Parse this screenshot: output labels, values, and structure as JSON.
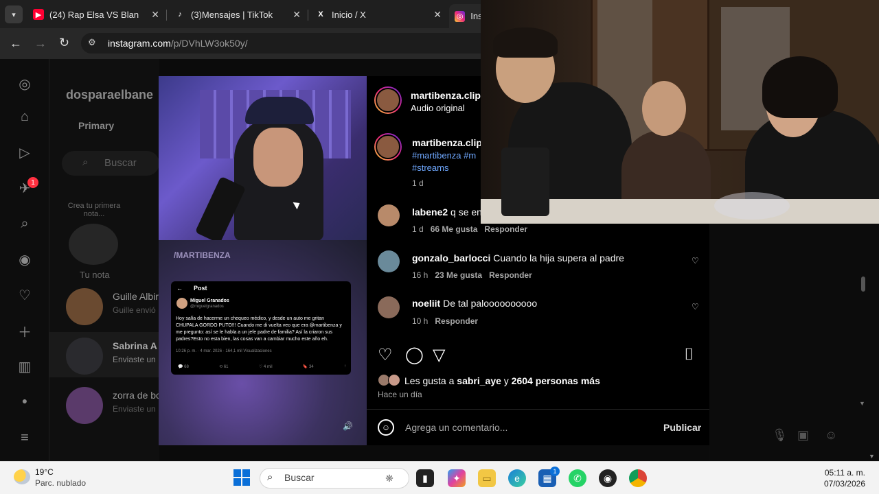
{
  "browser": {
    "tabs": [
      {
        "title": "(24) Rap Elsa VS Blancanieves",
        "favicon": "youtube-icon",
        "color": "#ff0033"
      },
      {
        "title": "(3)Mensajes | TikTok",
        "favicon": "tiktok-icon",
        "color": "#000000"
      },
      {
        "title": "Inicio / X",
        "favicon": "x-icon",
        "color": "#000000"
      },
      {
        "title": "Ins",
        "favicon": "instagram-icon",
        "color": "#e1306c"
      }
    ],
    "url_domain": "instagram.com",
    "url_path": "/p/DVhLW3ok50y/"
  },
  "sidebar": {
    "notification_count": "1"
  },
  "dm_panel": {
    "username": "dosparaelbane",
    "tab_primary": "Primary",
    "search_placeholder": "Buscar",
    "note_prompt": "Crea tu primera nota...",
    "your_note": "Tu nota",
    "conversations": [
      {
        "name": "Guille Albir",
        "preview": "Guille envió"
      },
      {
        "name": "Sabrina A",
        "preview": "Enviaste un"
      },
      {
        "name": "zorra de bo",
        "preview": "Enviaste un"
      }
    ]
  },
  "post": {
    "author": "martibenza.clips",
    "audio": "Audio original",
    "caption_user": "martibenza.clips",
    "hashtags_line1": "#martibenza #m",
    "hashtags_line2": "#streams",
    "caption_age": "1 d",
    "video_watermark": "/MARTIBENZA",
    "tweet": {
      "header": "Post",
      "name": "Miguel Granados",
      "handle": "@miguelgranados",
      "text": "Hoy salía de hacerme un chequeo médico, y desde un auto me gritan CHUPALA GORDO PUTO!!! Cuando me di vuelta veo que era @martibenza y me pregunto: así se le habla a un jefe padre de familia? Así la criaron sus padres?Esto no esta bien, las cosas van a cambiar mucho este año eh.",
      "meta": "10:26 p. m. · 4 mar. 2026 · 164,1 mil Visualizaciones",
      "replies": "68",
      "reposts": "61",
      "likes": "4 mil",
      "bookmarks": "34"
    },
    "comments": [
      {
        "user": "labene2",
        "text": "q se en",
        "age": "1 d",
        "likes": "66 Me gusta",
        "reply": "Responder"
      },
      {
        "user": "gonzalo_barlocci",
        "text": "Cuando la hija supera al padre",
        "age": "16 h",
        "likes": "23 Me gusta",
        "reply": "Responder"
      },
      {
        "user": "noeliit",
        "text": "De tal paloooooooooo",
        "age": "10 h",
        "reply": "Responder"
      }
    ],
    "likes_prefix": "Les gusta a",
    "likes_user": "sabri_aye",
    "likes_connector": "y",
    "likes_rest": "2604 personas más",
    "posted_ago": "Hace un día",
    "comment_placeholder": "Agrega un comentario...",
    "publish": "Publicar"
  },
  "taskbar": {
    "temperature": "19°C",
    "weather": "Parc. nublado",
    "search": "Buscar",
    "store_badge": "1",
    "time": "05:11 a. m.",
    "date": "07/03/2026"
  },
  "colors": {
    "link": "#6fa8ff",
    "badge": "#ff3040",
    "windows_blue": "#0a6fd8"
  }
}
